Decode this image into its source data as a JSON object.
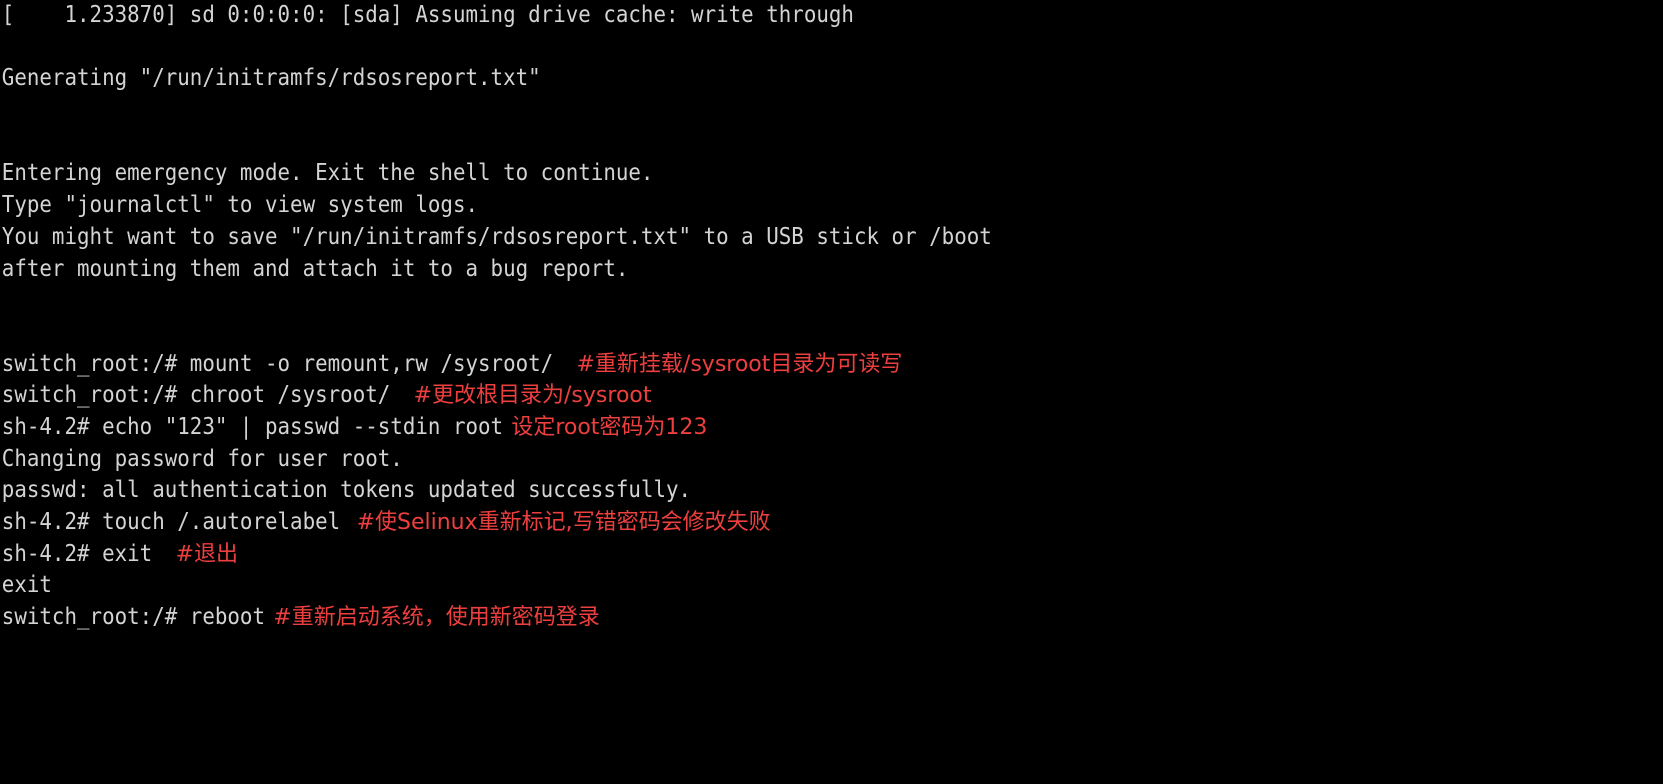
{
  "screen": {
    "title": "Linux emergency mode console",
    "background_color": "#000000",
    "text_color": "#d4d4d4",
    "annotation_color": "#ee3f3f",
    "rows": 24,
    "columns": 80
  },
  "lines": [
    {
      "id": "kernel-msg",
      "text": "[    1.233870] sd 0:0:0:0: [sda] Assuming drive cache: write through"
    },
    {
      "id": "blank-1",
      "text": ""
    },
    {
      "id": "generating-report",
      "text": "Generating \"/run/initramfs/rdsosreport.txt\""
    },
    {
      "id": "blank-2",
      "text": ""
    },
    {
      "id": "blank-3",
      "text": ""
    },
    {
      "id": "entering-emergency",
      "text": "Entering emergency mode. Exit the shell to continue."
    },
    {
      "id": "type-journalctl",
      "text": "Type \"journalctl\" to view system logs."
    },
    {
      "id": "save-hint-1",
      "text": "You might want to save \"/run/initramfs/rdsosreport.txt\" to a USB stick or /boot"
    },
    {
      "id": "save-hint-2",
      "text": "after mounting them and attach it to a bug report."
    },
    {
      "id": "blank-4",
      "text": ""
    },
    {
      "id": "blank-5",
      "text": ""
    },
    {
      "id": "cmd-mount",
      "text": "switch_root:/# mount -o remount,rw /sysroot/",
      "note": "#重新挂载/sysroot目录为可读写",
      "note_gap": "lg"
    },
    {
      "id": "cmd-chroot",
      "text": "switch_root:/# chroot /sysroot/",
      "note": "#更改根目录为/sysroot",
      "note_gap": "lg"
    },
    {
      "id": "cmd-passwd",
      "text": "sh-4.2# echo \"123\" | passwd --stdin root",
      "note": "设定root密码为123",
      "note_gap": "sm"
    },
    {
      "id": "out-changing-password",
      "text": "Changing password for user root."
    },
    {
      "id": "out-passwd-success",
      "text": "passwd: all authentication tokens updated successfully."
    },
    {
      "id": "cmd-touch-autorelabel",
      "text": "sh-4.2# touch /.autorelabel",
      "note": "#使Selinux重新标记,写错密码会修改失败",
      "note_gap": "md"
    },
    {
      "id": "cmd-exit",
      "text": "sh-4.2# exit",
      "note": "#退出",
      "note_gap": "lg"
    },
    {
      "id": "out-exit",
      "text": "exit"
    },
    {
      "id": "cmd-reboot",
      "text": "switch_root:/# reboot",
      "note": "#重新启动系统，使用新密码登录",
      "note_gap": "sm"
    },
    {
      "id": "blank-6",
      "text": ""
    },
    {
      "id": "blank-7",
      "text": ""
    },
    {
      "id": "blank-8",
      "text": ""
    },
    {
      "id": "blank-9",
      "text": ""
    }
  ]
}
